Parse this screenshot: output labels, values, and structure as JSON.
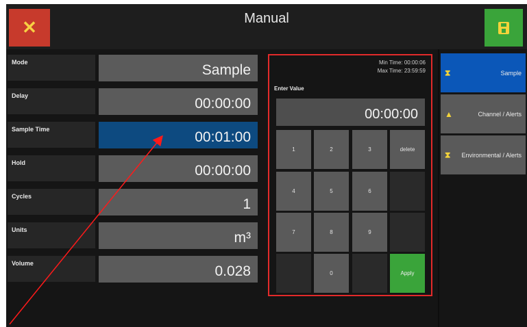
{
  "header": {
    "title": "Manual",
    "close_icon": "✕",
    "save_icon": "save-icon"
  },
  "fields": [
    {
      "label": "Mode",
      "value": "Sample"
    },
    {
      "label": "Delay",
      "value": "00:00:00"
    },
    {
      "label": "Sample Time",
      "value": "00:01:00"
    },
    {
      "label": "Hold",
      "value": "00:00:00"
    },
    {
      "label": "Cycles",
      "value": "1"
    },
    {
      "label": "Units",
      "value": "m³"
    },
    {
      "label": "Volume",
      "value": "0.028"
    }
  ],
  "keypad": {
    "min_time": "Min Time: 00:00:06",
    "max_time": "Max Time: 23:59:59",
    "enter_label": "Enter Value",
    "display": "00:00:00",
    "keys": {
      "k1": "1",
      "k2": "2",
      "k3": "3",
      "delete": "delete",
      "k4": "4",
      "k5": "5",
      "k6": "6",
      "k7": "7",
      "k8": "8",
      "k9": "9",
      "k0": "0",
      "apply": "Apply"
    }
  },
  "sidebar": {
    "tabs": [
      {
        "label": "Sample",
        "icon": "hourglass-icon",
        "active": true
      },
      {
        "label": "Channel / Alerts",
        "icon": "alert-icon",
        "active": false
      },
      {
        "label": "Environmental / Alerts",
        "icon": "hourglass-icon",
        "active": false
      }
    ]
  },
  "colors": {
    "highlight": "#e32a2a",
    "selected_field": "#0d4a80",
    "active_tab": "#0b57b8",
    "apply": "#3aa43a",
    "close": "#c73a2c"
  }
}
